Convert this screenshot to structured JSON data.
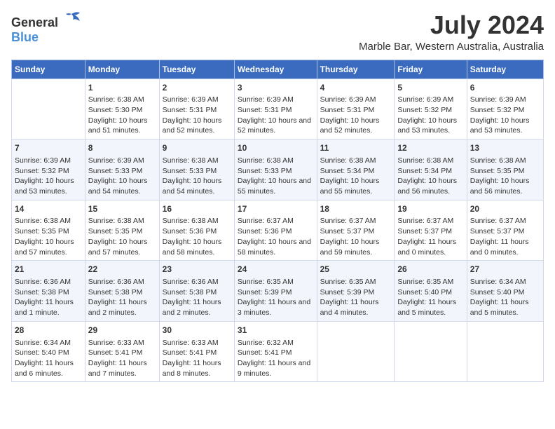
{
  "header": {
    "logo_general": "General",
    "logo_blue": "Blue",
    "main_title": "July 2024",
    "subtitle": "Marble Bar, Western Australia, Australia"
  },
  "days_of_week": [
    "Sunday",
    "Monday",
    "Tuesday",
    "Wednesday",
    "Thursday",
    "Friday",
    "Saturday"
  ],
  "weeks": [
    [
      {
        "day": "",
        "sunrise": "",
        "sunset": "",
        "daylight": ""
      },
      {
        "day": "1",
        "sunrise": "Sunrise: 6:38 AM",
        "sunset": "Sunset: 5:30 PM",
        "daylight": "Daylight: 10 hours and 51 minutes."
      },
      {
        "day": "2",
        "sunrise": "Sunrise: 6:39 AM",
        "sunset": "Sunset: 5:31 PM",
        "daylight": "Daylight: 10 hours and 52 minutes."
      },
      {
        "day": "3",
        "sunrise": "Sunrise: 6:39 AM",
        "sunset": "Sunset: 5:31 PM",
        "daylight": "Daylight: 10 hours and 52 minutes."
      },
      {
        "day": "4",
        "sunrise": "Sunrise: 6:39 AM",
        "sunset": "Sunset: 5:31 PM",
        "daylight": "Daylight: 10 hours and 52 minutes."
      },
      {
        "day": "5",
        "sunrise": "Sunrise: 6:39 AM",
        "sunset": "Sunset: 5:32 PM",
        "daylight": "Daylight: 10 hours and 53 minutes."
      },
      {
        "day": "6",
        "sunrise": "Sunrise: 6:39 AM",
        "sunset": "Sunset: 5:32 PM",
        "daylight": "Daylight: 10 hours and 53 minutes."
      }
    ],
    [
      {
        "day": "7",
        "sunrise": "Sunrise: 6:39 AM",
        "sunset": "Sunset: 5:32 PM",
        "daylight": "Daylight: 10 hours and 53 minutes."
      },
      {
        "day": "8",
        "sunrise": "Sunrise: 6:39 AM",
        "sunset": "Sunset: 5:33 PM",
        "daylight": "Daylight: 10 hours and 54 minutes."
      },
      {
        "day": "9",
        "sunrise": "Sunrise: 6:38 AM",
        "sunset": "Sunset: 5:33 PM",
        "daylight": "Daylight: 10 hours and 54 minutes."
      },
      {
        "day": "10",
        "sunrise": "Sunrise: 6:38 AM",
        "sunset": "Sunset: 5:33 PM",
        "daylight": "Daylight: 10 hours and 55 minutes."
      },
      {
        "day": "11",
        "sunrise": "Sunrise: 6:38 AM",
        "sunset": "Sunset: 5:34 PM",
        "daylight": "Daylight: 10 hours and 55 minutes."
      },
      {
        "day": "12",
        "sunrise": "Sunrise: 6:38 AM",
        "sunset": "Sunset: 5:34 PM",
        "daylight": "Daylight: 10 hours and 56 minutes."
      },
      {
        "day": "13",
        "sunrise": "Sunrise: 6:38 AM",
        "sunset": "Sunset: 5:35 PM",
        "daylight": "Daylight: 10 hours and 56 minutes."
      }
    ],
    [
      {
        "day": "14",
        "sunrise": "Sunrise: 6:38 AM",
        "sunset": "Sunset: 5:35 PM",
        "daylight": "Daylight: 10 hours and 57 minutes."
      },
      {
        "day": "15",
        "sunrise": "Sunrise: 6:38 AM",
        "sunset": "Sunset: 5:35 PM",
        "daylight": "Daylight: 10 hours and 57 minutes."
      },
      {
        "day": "16",
        "sunrise": "Sunrise: 6:38 AM",
        "sunset": "Sunset: 5:36 PM",
        "daylight": "Daylight: 10 hours and 58 minutes."
      },
      {
        "day": "17",
        "sunrise": "Sunrise: 6:37 AM",
        "sunset": "Sunset: 5:36 PM",
        "daylight": "Daylight: 10 hours and 58 minutes."
      },
      {
        "day": "18",
        "sunrise": "Sunrise: 6:37 AM",
        "sunset": "Sunset: 5:37 PM",
        "daylight": "Daylight: 10 hours and 59 minutes."
      },
      {
        "day": "19",
        "sunrise": "Sunrise: 6:37 AM",
        "sunset": "Sunset: 5:37 PM",
        "daylight": "Daylight: 11 hours and 0 minutes."
      },
      {
        "day": "20",
        "sunrise": "Sunrise: 6:37 AM",
        "sunset": "Sunset: 5:37 PM",
        "daylight": "Daylight: 11 hours and 0 minutes."
      }
    ],
    [
      {
        "day": "21",
        "sunrise": "Sunrise: 6:36 AM",
        "sunset": "Sunset: 5:38 PM",
        "daylight": "Daylight: 11 hours and 1 minute."
      },
      {
        "day": "22",
        "sunrise": "Sunrise: 6:36 AM",
        "sunset": "Sunset: 5:38 PM",
        "daylight": "Daylight: 11 hours and 2 minutes."
      },
      {
        "day": "23",
        "sunrise": "Sunrise: 6:36 AM",
        "sunset": "Sunset: 5:38 PM",
        "daylight": "Daylight: 11 hours and 2 minutes."
      },
      {
        "day": "24",
        "sunrise": "Sunrise: 6:35 AM",
        "sunset": "Sunset: 5:39 PM",
        "daylight": "Daylight: 11 hours and 3 minutes."
      },
      {
        "day": "25",
        "sunrise": "Sunrise: 6:35 AM",
        "sunset": "Sunset: 5:39 PM",
        "daylight": "Daylight: 11 hours and 4 minutes."
      },
      {
        "day": "26",
        "sunrise": "Sunrise: 6:35 AM",
        "sunset": "Sunset: 5:40 PM",
        "daylight": "Daylight: 11 hours and 5 minutes."
      },
      {
        "day": "27",
        "sunrise": "Sunrise: 6:34 AM",
        "sunset": "Sunset: 5:40 PM",
        "daylight": "Daylight: 11 hours and 5 minutes."
      }
    ],
    [
      {
        "day": "28",
        "sunrise": "Sunrise: 6:34 AM",
        "sunset": "Sunset: 5:40 PM",
        "daylight": "Daylight: 11 hours and 6 minutes."
      },
      {
        "day": "29",
        "sunrise": "Sunrise: 6:33 AM",
        "sunset": "Sunset: 5:41 PM",
        "daylight": "Daylight: 11 hours and 7 minutes."
      },
      {
        "day": "30",
        "sunrise": "Sunrise: 6:33 AM",
        "sunset": "Sunset: 5:41 PM",
        "daylight": "Daylight: 11 hours and 8 minutes."
      },
      {
        "day": "31",
        "sunrise": "Sunrise: 6:32 AM",
        "sunset": "Sunset: 5:41 PM",
        "daylight": "Daylight: 11 hours and 9 minutes."
      },
      {
        "day": "",
        "sunrise": "",
        "sunset": "",
        "daylight": ""
      },
      {
        "day": "",
        "sunrise": "",
        "sunset": "",
        "daylight": ""
      },
      {
        "day": "",
        "sunrise": "",
        "sunset": "",
        "daylight": ""
      }
    ]
  ]
}
